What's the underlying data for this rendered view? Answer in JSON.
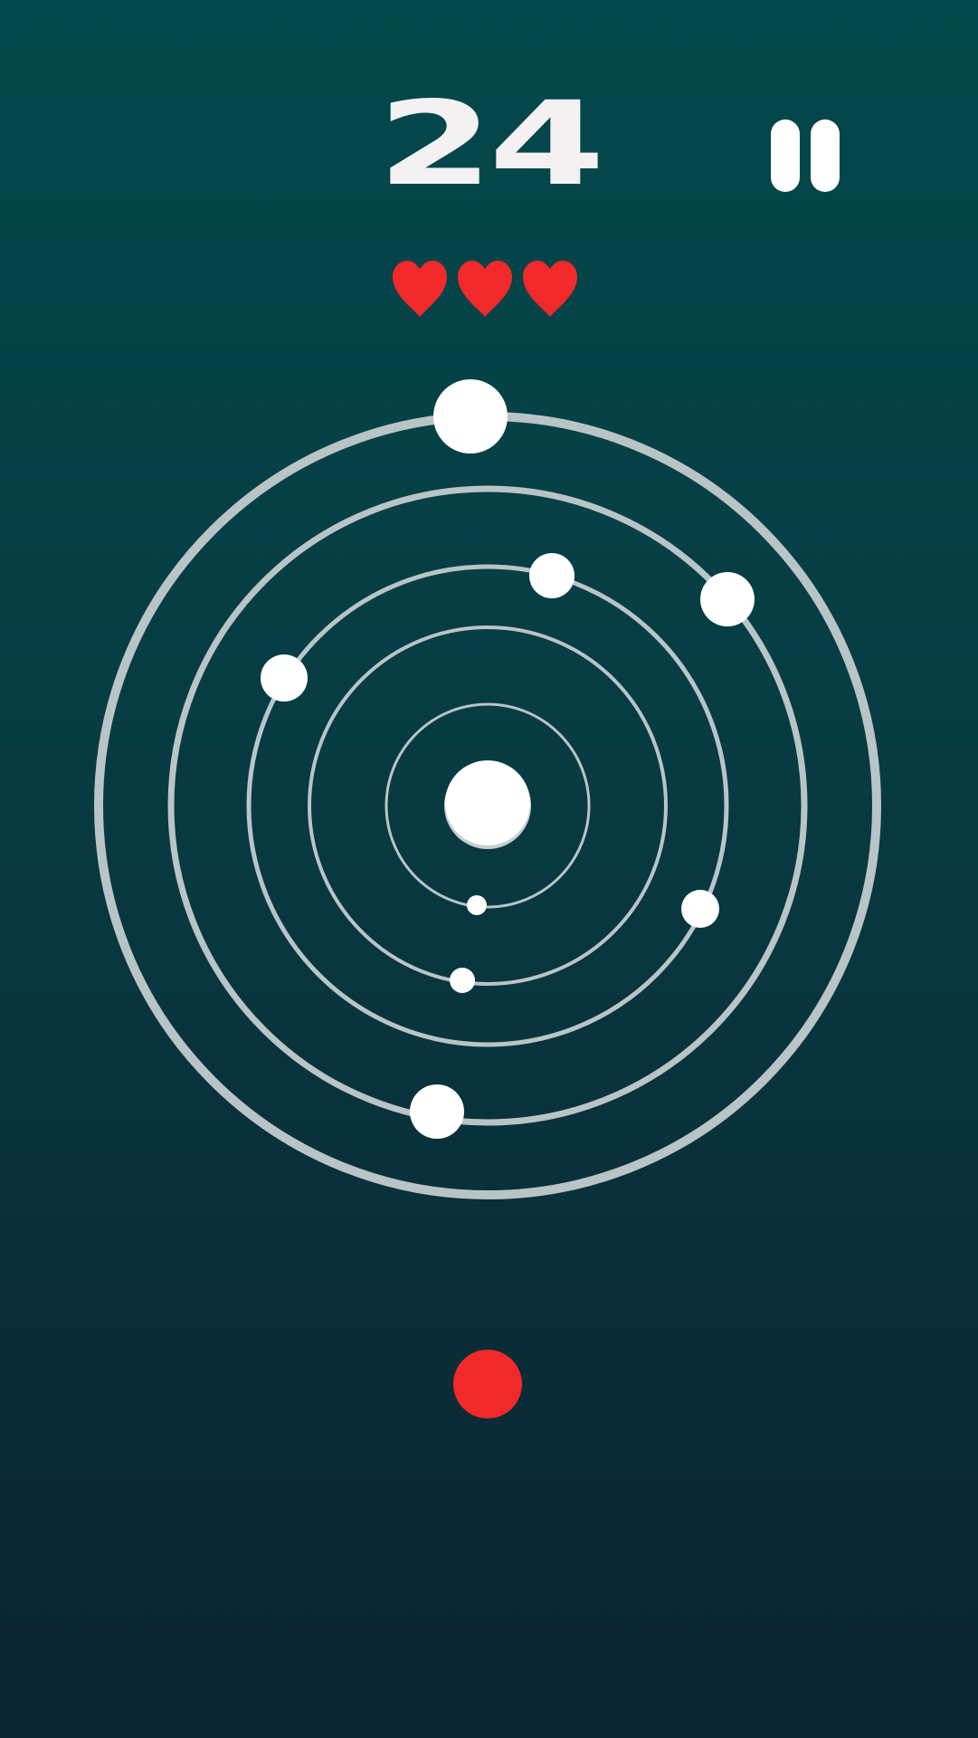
{
  "game": {
    "score": "24",
    "lives": 3,
    "heart_color": "#f2292b",
    "projectile_color": "#f2292b",
    "ring_color": "#b9c4c6",
    "planet_color": "#ffffff",
    "background_colors": [
      "#03494b",
      "#0b2431"
    ]
  },
  "controls": {
    "pause_icon": "pause-icon"
  },
  "icons": {
    "heart": "heart-icon"
  }
}
